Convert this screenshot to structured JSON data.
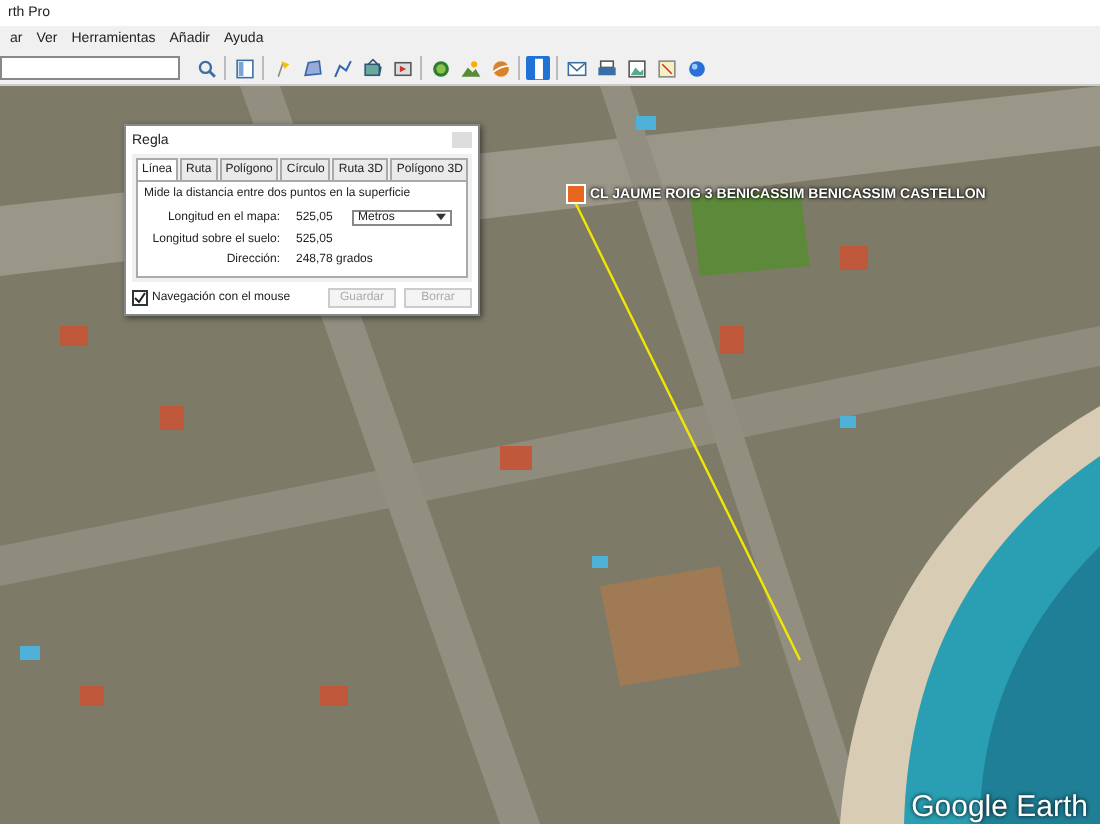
{
  "window": {
    "title": "rth Pro"
  },
  "menu": [
    {
      "label": "ar"
    },
    {
      "label": "Ver"
    },
    {
      "label": "Herramientas"
    },
    {
      "label": "Añadir"
    },
    {
      "label": "Ayuda"
    }
  ],
  "toolbar": {
    "tools": [
      {
        "kind": "search",
        "selected": false
      },
      {
        "kind": "sidebar",
        "selected": false
      },
      {
        "kind": "pin",
        "selected": false
      },
      {
        "kind": "polygon",
        "selected": false
      },
      {
        "kind": "path",
        "selected": false
      },
      {
        "kind": "overlay",
        "selected": false
      },
      {
        "kind": "tour",
        "selected": false
      },
      {
        "kind": "history",
        "selected": false
      },
      {
        "kind": "sun",
        "selected": false
      },
      {
        "kind": "planet",
        "selected": false
      },
      {
        "kind": "ruler",
        "selected": true
      },
      {
        "kind": "email",
        "selected": false
      },
      {
        "kind": "print",
        "selected": false
      },
      {
        "kind": "save-image",
        "selected": false
      },
      {
        "kind": "maps",
        "selected": false
      },
      {
        "kind": "globe",
        "selected": false
      }
    ]
  },
  "map": {
    "place_label": "CL JAUME ROIG 3 BENICASSIM BENICASSIM CASTELLON",
    "logo": "Google Earth"
  },
  "ruler_dialog": {
    "title": "Regla",
    "tabs": [
      {
        "label": "Línea",
        "selected": true
      },
      {
        "label": "Ruta",
        "selected": false
      },
      {
        "label": "Polígono",
        "selected": false
      },
      {
        "label": "Círculo",
        "selected": false
      },
      {
        "label": "Ruta 3D",
        "selected": false
      },
      {
        "label": "Polígono 3D",
        "selected": false
      }
    ],
    "description": "Mide la distancia entre dos puntos en la superficie",
    "rows": [
      {
        "label": "Longitud en el mapa:",
        "value": "525,05",
        "unit": "Metros"
      },
      {
        "label": "Longitud sobre el suelo:",
        "value": "525,05"
      },
      {
        "label": "Dirección:",
        "value": "248,78 grados"
      }
    ],
    "mouse_navigation": {
      "label": "Navegación con el mouse",
      "checked": true
    },
    "buttons": [
      {
        "label": "Guardar",
        "disabled": true
      },
      {
        "label": "Borrar",
        "disabled": true
      }
    ]
  }
}
